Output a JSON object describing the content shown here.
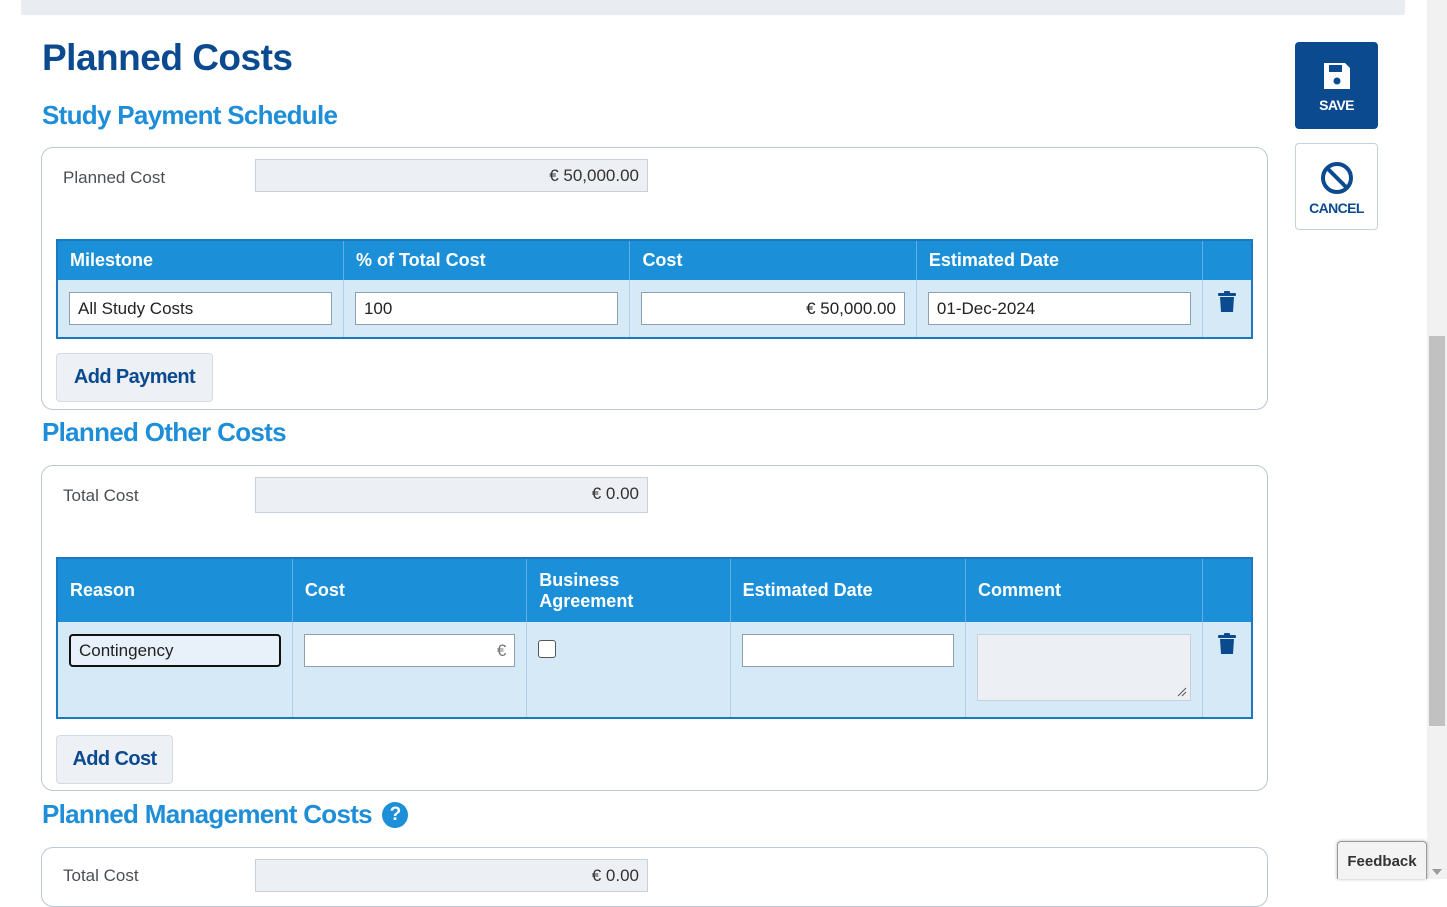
{
  "page": {
    "title": "Planned Costs"
  },
  "actions": {
    "save_label": "SAVE",
    "cancel_label": "CANCEL"
  },
  "payment_schedule": {
    "title": "Study Payment Schedule",
    "planned_cost_label": "Planned Cost",
    "planned_cost_value": "€ 50,000.00",
    "columns": [
      "Milestone",
      "% of Total Cost",
      "Cost",
      "Estimated Date"
    ],
    "rows": [
      {
        "milestone": "All Study Costs",
        "percent": "100",
        "cost": "€ 50,000.00",
        "date": "01-Dec-2024"
      }
    ],
    "add_label": "Add Payment"
  },
  "other_costs": {
    "title": "Planned Other Costs",
    "total_label": "Total Cost",
    "total_value": "€ 0.00",
    "columns": [
      "Reason",
      "Cost",
      "Business Agreement",
      "Estimated Date",
      "Comment"
    ],
    "rows": [
      {
        "reason": "Contingency",
        "cost": "€",
        "business_agreement": false,
        "date": "",
        "comment": ""
      }
    ],
    "add_label": "Add Cost"
  },
  "management_costs": {
    "title": "Planned Management Costs",
    "help_glyph": "?",
    "total_label": "Total Cost",
    "total_value": "€ 0.00"
  },
  "feedback_label": "Feedback",
  "colors": {
    "primary_dark": "#0b4a8f",
    "accent": "#1b8fd8",
    "row_bg": "#d6e9f7"
  },
  "icons": {
    "save": "floppy-disk-icon",
    "cancel": "ban-icon",
    "delete": "trash-icon",
    "help": "question-circle-icon"
  }
}
